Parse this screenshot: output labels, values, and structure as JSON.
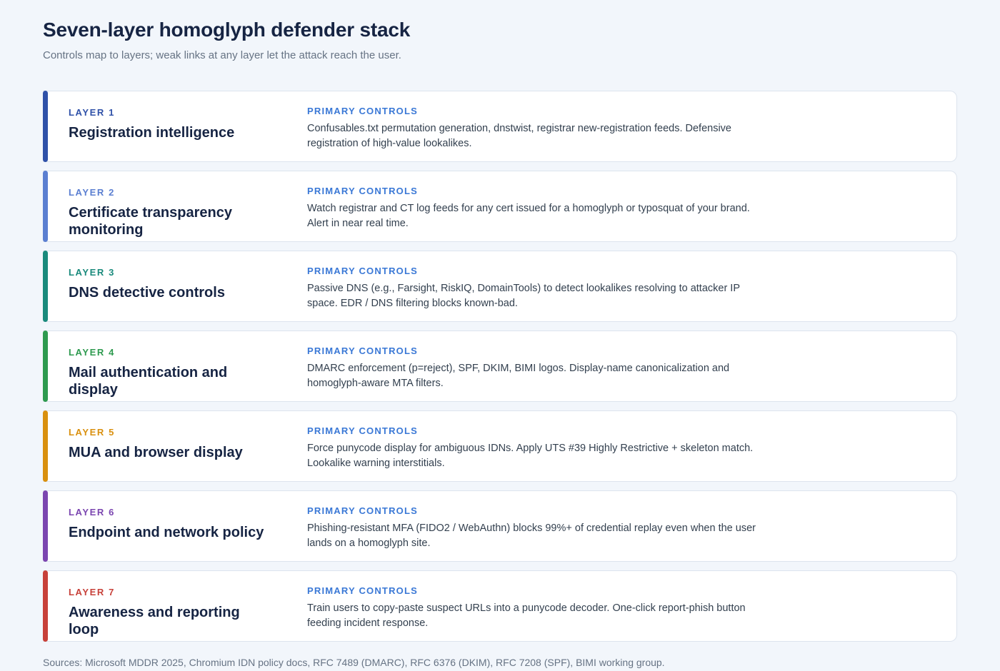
{
  "title": "Seven-layer homoglyph defender stack",
  "subtitle": "Controls map to layers; weak links at any layer let the attack reach the user.",
  "layers": [
    {
      "number_label": "LAYER 1",
      "name": "Registration intelligence",
      "controls_label": "PRIMARY CONTROLS",
      "controls": "Confusables.txt permutation generation, dnstwist, registrar new-registration feeds. Defensive registration of high-value lookalikes.",
      "color": "#2f51a8"
    },
    {
      "number_label": "LAYER 2",
      "name": "Certificate transparency monitoring",
      "controls_label": "PRIMARY CONTROLS",
      "controls": "Watch registrar and CT log feeds for any cert issued for a homoglyph or typosquat of your brand. Alert in near real time.",
      "color": "#5b7fd1"
    },
    {
      "number_label": "LAYER 3",
      "name": "DNS detective controls",
      "controls_label": "PRIMARY CONTROLS",
      "controls": "Passive DNS (e.g., Farsight, RiskIQ, DomainTools) to detect lookalikes resolving to attacker IP space. EDR / DNS filtering blocks known-bad.",
      "color": "#1a8a7c"
    },
    {
      "number_label": "LAYER 4",
      "name": "Mail authentication and display",
      "controls_label": "PRIMARY CONTROLS",
      "controls": "DMARC enforcement (p=reject), SPF, DKIM, BIMI logos. Display-name canonicalization and homoglyph-aware MTA filters.",
      "color": "#2e9a4f"
    },
    {
      "number_label": "LAYER 5",
      "name": "MUA and browser display",
      "controls_label": "PRIMARY CONTROLS",
      "controls": "Force punycode display for ambiguous IDNs. Apply UTS #39 Highly Restrictive + skeleton match. Lookalike warning interstitials.",
      "color": "#d9900f"
    },
    {
      "number_label": "LAYER 6",
      "name": "Endpoint and network policy",
      "controls_label": "PRIMARY CONTROLS",
      "controls": "Phishing-resistant MFA (FIDO2 / WebAuthn) blocks 99%+ of credential replay even when the user lands on a homoglyph site.",
      "color": "#7b46b0"
    },
    {
      "number_label": "LAYER 7",
      "name": "Awareness and reporting loop",
      "controls_label": "PRIMARY CONTROLS",
      "controls": "Train users to copy-paste suspect URLs into a punycode decoder. One-click report-phish button feeding incident response.",
      "color": "#c7413a"
    }
  ],
  "sources": "Sources: Microsoft MDDR 2025, Chromium IDN policy docs, RFC 7489 (DMARC), RFC 6376 (DKIM), RFC 7208 (SPF), BIMI working group."
}
